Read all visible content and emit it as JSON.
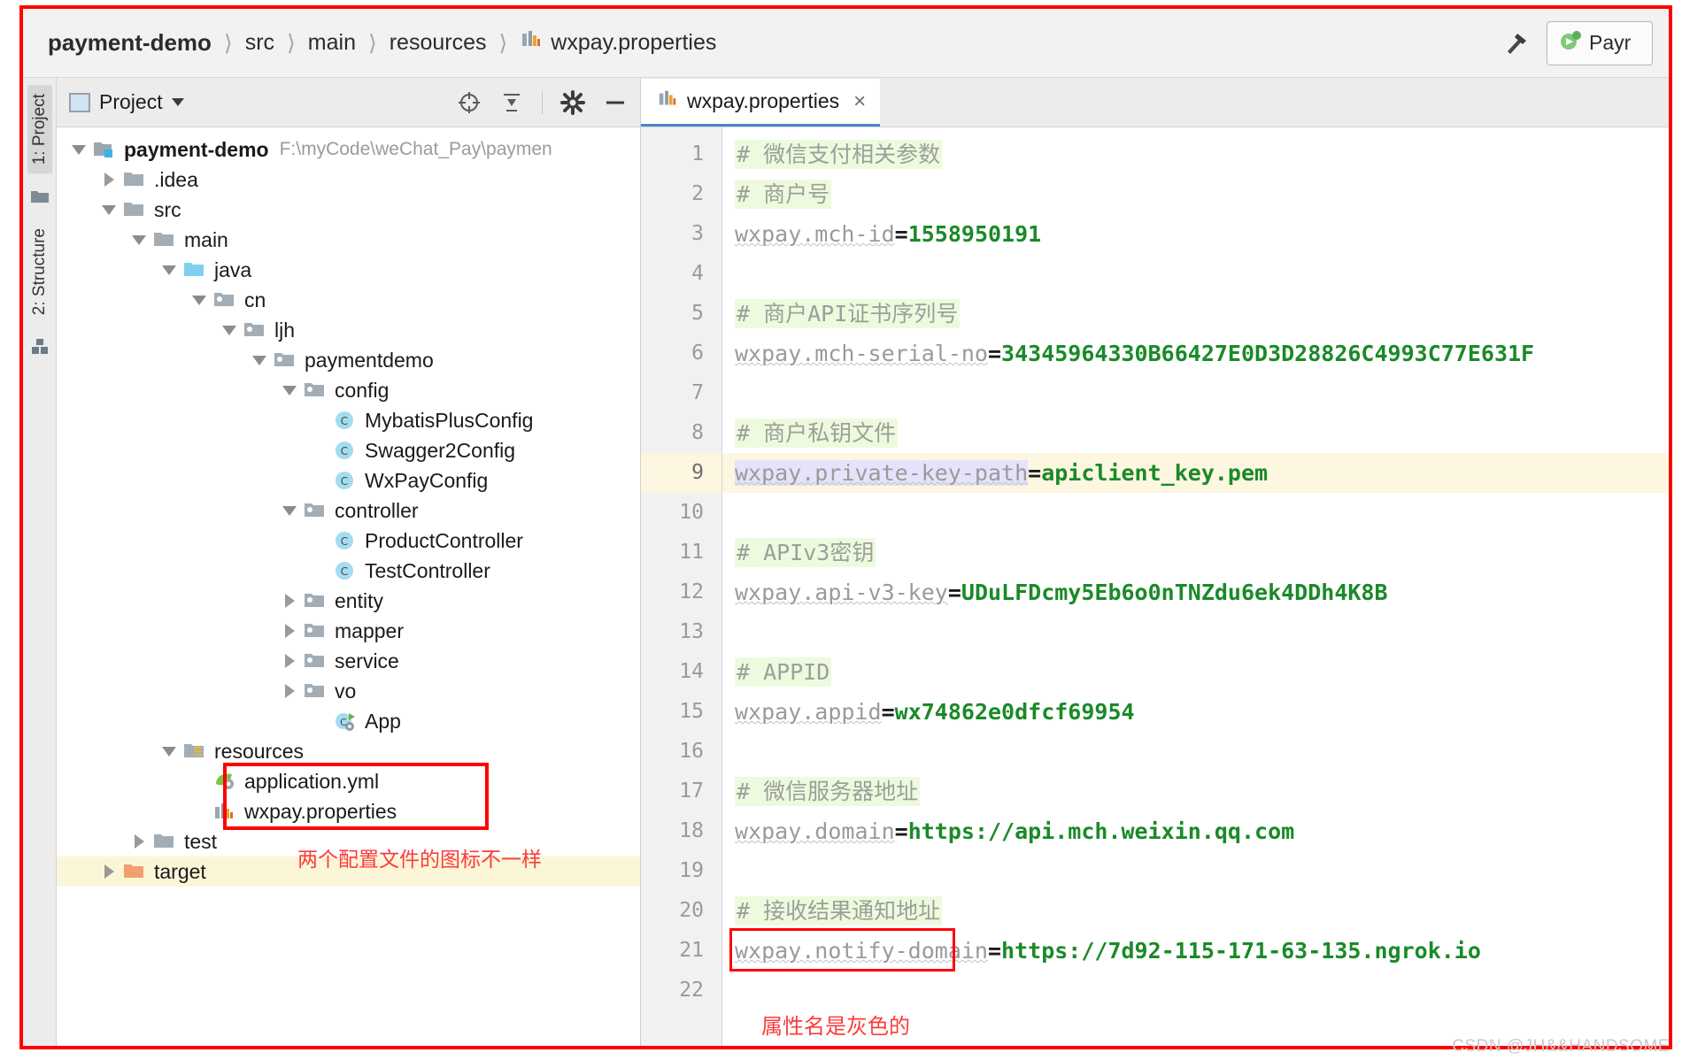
{
  "window": {
    "breadcrumb": [
      "payment-demo",
      "src",
      "main",
      "resources",
      "wxpay.properties"
    ],
    "run_config_label": "Payr",
    "hammer_icon": "hammer-icon",
    "file_icon": "properties-file-icon"
  },
  "tool_strip": {
    "tabs": [
      "1: Project",
      "2: Structure"
    ],
    "icons": [
      "folder-icon",
      "module-icon"
    ]
  },
  "project_panel": {
    "title": "Project",
    "actions": [
      "collapse-target-icon",
      "collapse-all-icon",
      "settings-gear-icon",
      "hide-icon"
    ],
    "tree": [
      {
        "label": "payment-demo",
        "sub": "F:\\myCode\\weChat_Pay\\paymen",
        "depth": 0,
        "state": "open",
        "icon": "project-module-icon",
        "bold": true
      },
      {
        "label": ".idea",
        "sub": "",
        "depth": 1,
        "state": "closed",
        "icon": "folder-icon",
        "bold": false
      },
      {
        "label": "src",
        "sub": "",
        "depth": 1,
        "state": "open",
        "icon": "folder-icon",
        "bold": false
      },
      {
        "label": "main",
        "sub": "",
        "depth": 2,
        "state": "open",
        "icon": "folder-icon",
        "bold": false
      },
      {
        "label": "java",
        "sub": "",
        "depth": 3,
        "state": "open",
        "icon": "source-root-folder-icon",
        "bold": false
      },
      {
        "label": "cn",
        "sub": "",
        "depth": 4,
        "state": "open",
        "icon": "package-icon",
        "bold": false
      },
      {
        "label": "ljh",
        "sub": "",
        "depth": 5,
        "state": "open",
        "icon": "package-icon",
        "bold": false
      },
      {
        "label": "paymentdemo",
        "sub": "",
        "depth": 6,
        "state": "open",
        "icon": "package-icon",
        "bold": false
      },
      {
        "label": "config",
        "sub": "",
        "depth": 7,
        "state": "open",
        "icon": "package-icon",
        "bold": false
      },
      {
        "label": "MybatisPlusConfig",
        "sub": "",
        "depth": 8,
        "state": "none",
        "icon": "java-class-icon",
        "bold": false
      },
      {
        "label": "Swagger2Config",
        "sub": "",
        "depth": 8,
        "state": "none",
        "icon": "java-class-icon",
        "bold": false
      },
      {
        "label": "WxPayConfig",
        "sub": "",
        "depth": 8,
        "state": "none",
        "icon": "java-class-icon",
        "bold": false
      },
      {
        "label": "controller",
        "sub": "",
        "depth": 7,
        "state": "open",
        "icon": "package-icon",
        "bold": false
      },
      {
        "label": "ProductController",
        "sub": "",
        "depth": 8,
        "state": "none",
        "icon": "java-class-icon",
        "bold": false
      },
      {
        "label": "TestController",
        "sub": "",
        "depth": 8,
        "state": "none",
        "icon": "java-class-icon",
        "bold": false
      },
      {
        "label": "entity",
        "sub": "",
        "depth": 7,
        "state": "closed",
        "icon": "package-icon",
        "bold": false
      },
      {
        "label": "mapper",
        "sub": "",
        "depth": 7,
        "state": "closed",
        "icon": "package-icon",
        "bold": false
      },
      {
        "label": "service",
        "sub": "",
        "depth": 7,
        "state": "closed",
        "icon": "package-icon",
        "bold": false
      },
      {
        "label": "vo",
        "sub": "",
        "depth": 7,
        "state": "closed",
        "icon": "package-icon",
        "bold": false
      },
      {
        "label": "App",
        "sub": "",
        "depth": 8,
        "state": "none",
        "icon": "spring-boot-class-icon",
        "bold": false
      },
      {
        "label": "resources",
        "sub": "",
        "depth": 3,
        "state": "open",
        "icon": "resource-root-folder-icon",
        "bold": false
      },
      {
        "label": "application.yml",
        "sub": "",
        "depth": 4,
        "state": "none",
        "icon": "spring-yaml-file-icon",
        "bold": false
      },
      {
        "label": "wxpay.properties",
        "sub": "",
        "depth": 4,
        "state": "none",
        "icon": "properties-file-icon",
        "bold": false
      },
      {
        "label": "test",
        "sub": "",
        "depth": 2,
        "state": "closed",
        "icon": "folder-icon",
        "bold": false
      },
      {
        "label": "target",
        "sub": "",
        "depth": 1,
        "state": "closed",
        "icon": "excluded-folder-icon",
        "bold": false
      }
    ],
    "annotation": "两个配置文件的图标不一样"
  },
  "editor": {
    "tab_label": "wxpay.properties",
    "tab_close": "×",
    "current_line": 9,
    "annotation": "属性名是灰色的",
    "lines": [
      {
        "n": 1,
        "type": "comment",
        "text": "# 微信支付相关参数"
      },
      {
        "n": 2,
        "type": "comment",
        "text": "# 商户号"
      },
      {
        "n": 3,
        "type": "prop",
        "key": "wxpay.mch-id",
        "value": "1558950191"
      },
      {
        "n": 4,
        "type": "blank",
        "text": ""
      },
      {
        "n": 5,
        "type": "comment",
        "text": "# 商户API证书序列号"
      },
      {
        "n": 6,
        "type": "prop",
        "key": "wxpay.mch-serial-no",
        "value": "34345964330B66427E0D3D28826C4993C77E631F"
      },
      {
        "n": 7,
        "type": "blank",
        "text": ""
      },
      {
        "n": 8,
        "type": "comment",
        "text": "# 商户私钥文件"
      },
      {
        "n": 9,
        "type": "prop",
        "key": "wxpay.private-key-path",
        "value": "apiclient_key.pem"
      },
      {
        "n": 10,
        "type": "blank",
        "text": ""
      },
      {
        "n": 11,
        "type": "comment",
        "text": "# APIv3密钥"
      },
      {
        "n": 12,
        "type": "prop",
        "key": "wxpay.api-v3-key",
        "value": "UDuLFDcmy5Eb6o0nTNZdu6ek4DDh4K8B"
      },
      {
        "n": 13,
        "type": "blank",
        "text": ""
      },
      {
        "n": 14,
        "type": "comment",
        "text": "# APPID"
      },
      {
        "n": 15,
        "type": "prop",
        "key": "wxpay.appid",
        "value": "wx74862e0dfcf69954"
      },
      {
        "n": 16,
        "type": "blank",
        "text": ""
      },
      {
        "n": 17,
        "type": "comment",
        "text": "# 微信服务器地址"
      },
      {
        "n": 18,
        "type": "prop",
        "key": "wxpay.domain",
        "value": "https://api.mch.weixin.qq.com"
      },
      {
        "n": 19,
        "type": "blank",
        "text": ""
      },
      {
        "n": 20,
        "type": "comment",
        "text": "# 接收结果通知地址"
      },
      {
        "n": 21,
        "type": "prop",
        "key": "wxpay.notify-domain",
        "value": "https://7d92-115-171-63-135.ngrok.io"
      },
      {
        "n": 22,
        "type": "blank",
        "text": ""
      }
    ]
  },
  "watermark": "CSDN @JH&&HANDSOME",
  "colors": {
    "annotation_red": "#fa3c3c",
    "value_green": "#1a8a28",
    "key_gray": "#9a9a9a",
    "comment_bg": "#eefadd",
    "current_line_bg": "#fdf6e0",
    "identifier_hl": "#e6e2fb"
  }
}
